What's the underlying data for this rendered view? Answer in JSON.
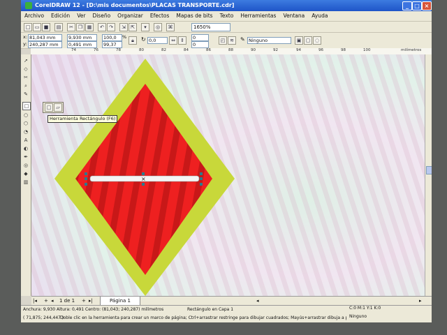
{
  "window": {
    "title": "CorelDRAW 12 - [D:\\mis documentos\\PLACAS TRANSPORTE.cdr]",
    "controls": [
      "_",
      "□",
      "×"
    ]
  },
  "menu": [
    "Archivo",
    "Edición",
    "Ver",
    "Diseño",
    "Organizar",
    "Efectos",
    "Mapas de bits",
    "Texto",
    "Herramientas",
    "Ventana",
    "Ayuda"
  ],
  "toolbar": {
    "zoom_value": "1650%"
  },
  "property_bar": {
    "x_label": "x:",
    "x_value": "81,043 mm",
    "y_label": "y:",
    "y_value": "240,287 mm",
    "width_value": "9,930 mm",
    "height_value": "0,491 mm",
    "scale_x": "100,0",
    "scale_y": "99,37",
    "percent": "%",
    "rotation_value": "0,0",
    "corner_top": "0",
    "corner_bottom": "0",
    "outline_value": "Ninguno"
  },
  "ruler_top_ticks": [
    "74",
    "76",
    "78",
    "80",
    "82",
    "84",
    "86",
    "88",
    "90",
    "92",
    "94",
    "96",
    "98",
    "100"
  ],
  "ruler_unit": "milímetros",
  "tooltip_text": "Herramienta Rectángulo (F6)",
  "page_nav": {
    "counter": "1 de 1",
    "tab_label": "Página 1"
  },
  "status": {
    "dimensions": "Anchura: 9,930  Altura: 0,491  Centro: (81,043; 240,287)  milímetros",
    "object_info": "Rectángulo en Capa 1",
    "fill_info": "C:0 M:1 Y:1 K:0",
    "cursor_position": "( 71,875; 244,447 )",
    "hint": "Doble clic en la herramienta para crear un marco de página; Ctrl+arrastrar restringe para dibujar cuadrados; Mayús+arrastrar dibuja a partir...",
    "outline_info": "Ninguno"
  },
  "colors": {
    "sign_border": "#c8d83a",
    "sign_fill": "#ee2020",
    "title_bar": "#1e55c8"
  }
}
